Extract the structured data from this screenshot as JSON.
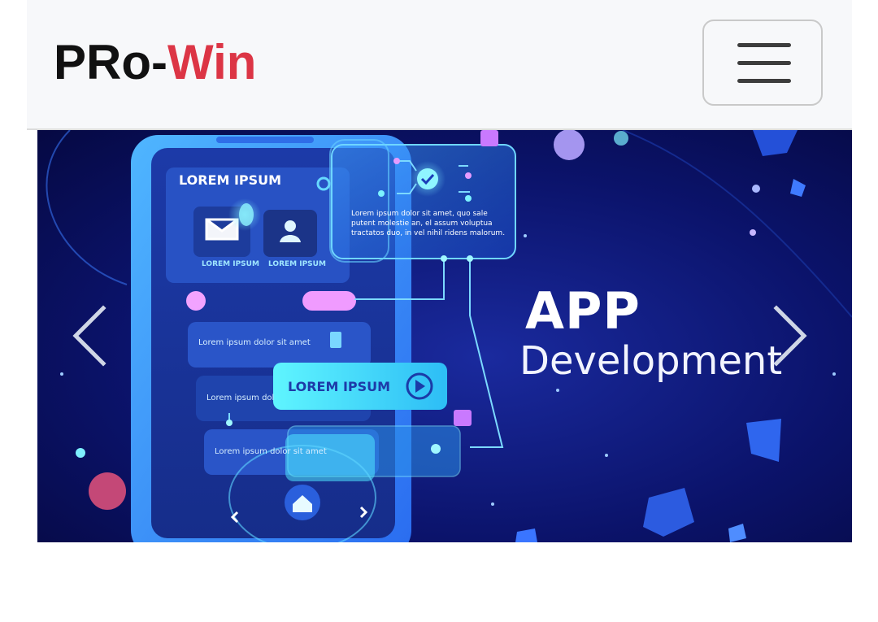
{
  "navbar": {
    "brand_prefix": "PRo-",
    "brand_accent": "Win",
    "menu_icon": "hamburger-menu-icon"
  },
  "carousel": {
    "title": "APP",
    "subtitle": "Development",
    "prev_icon": "chevron-left-icon",
    "next_icon": "chevron-right-icon",
    "phone_screen": {
      "header": "LOREM IPSUM",
      "tile1_label": "LOREM IPSUM",
      "tile2_label": "LOREM IPSUM",
      "row1": "Lorem ipsum dolor sit amet",
      "row2": "Lorem ipsum dolor sit amet",
      "row3": "Lorem ipsum dolor sit amet",
      "button": "LOREM IPSUM",
      "panel_text_1": "Lorem ipsum dolor sit amet, quo sale",
      "panel_text_2": "putent molestie an, el assum voluptua",
      "panel_text_3": "tractatos duo, in vel nihil ridens malorum."
    }
  },
  "colors": {
    "brand_accent": "#dc3545",
    "navbar_bg": "#f7f8fa",
    "slide_bg": "#0a1160"
  }
}
